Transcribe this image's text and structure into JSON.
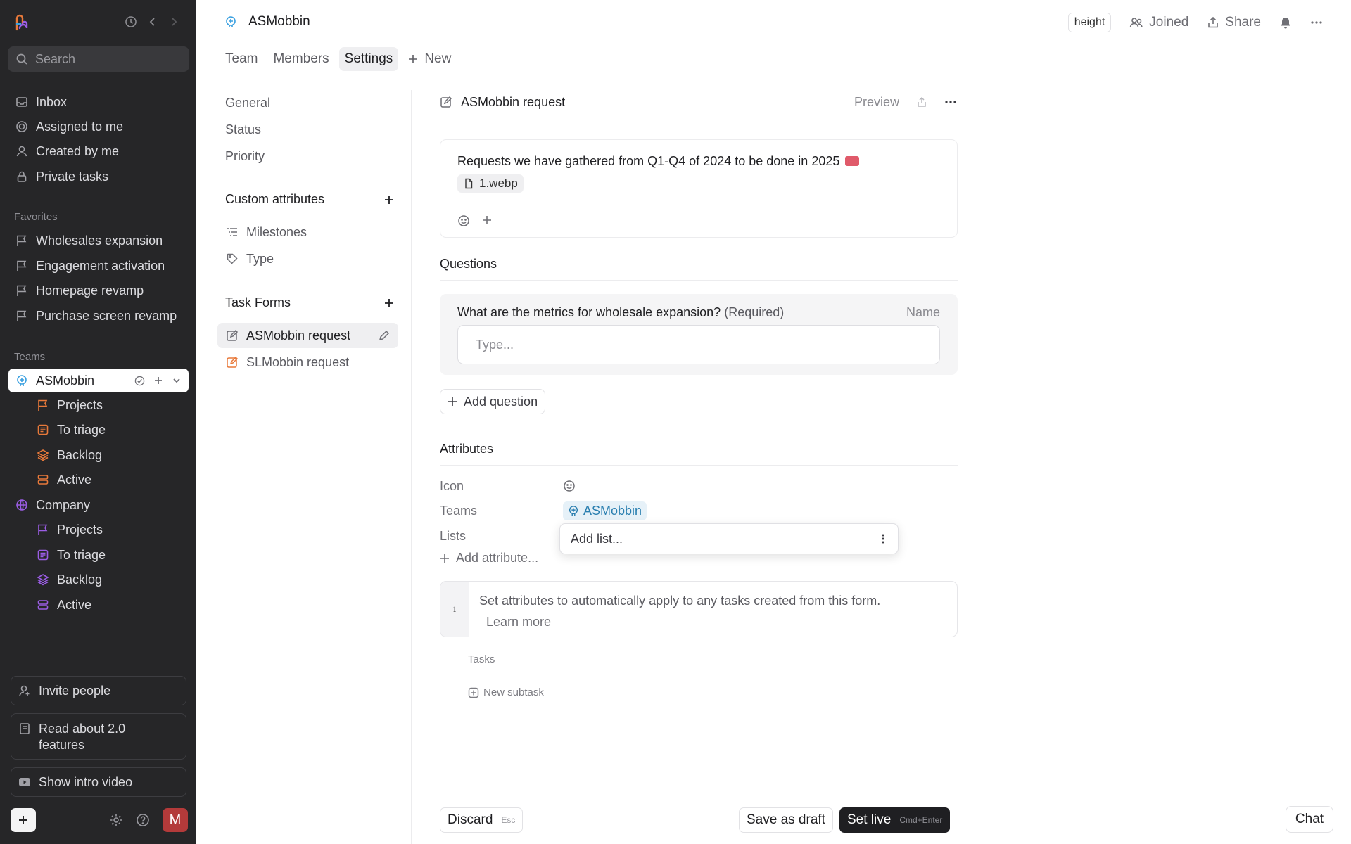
{
  "sidebar": {
    "search_placeholder": "Search",
    "nav": [
      {
        "label": "Inbox",
        "icon": "inbox-icon"
      },
      {
        "label": "Assigned to me",
        "icon": "target-icon"
      },
      {
        "label": "Created by me",
        "icon": "user-icon"
      },
      {
        "label": "Private tasks",
        "icon": "lock-icon"
      }
    ],
    "favorites_heading": "Favorites",
    "favorites": [
      {
        "label": "Wholesales expansion",
        "icon": "flag-icon"
      },
      {
        "label": "Engagement activation",
        "icon": "flag-icon"
      },
      {
        "label": "Homepage revamp",
        "icon": "flag-icon"
      },
      {
        "label": "Purchase screen revamp",
        "icon": "flag-icon"
      }
    ],
    "teams_heading": "Teams",
    "team_asmobbin": {
      "name": "ASMobbin",
      "items": [
        {
          "label": "Projects",
          "icon": "flag-icon"
        },
        {
          "label": "To triage",
          "icon": "triage-icon"
        },
        {
          "label": "Backlog",
          "icon": "layers-icon"
        },
        {
          "label": "Active",
          "icon": "stack-icon"
        }
      ]
    },
    "team_company": {
      "name": "Company",
      "items": [
        {
          "label": "Projects",
          "icon": "flag-icon"
        },
        {
          "label": "To triage",
          "icon": "triage-icon"
        },
        {
          "label": "Backlog",
          "icon": "layers-icon"
        },
        {
          "label": "Active",
          "icon": "stack-icon"
        }
      ]
    },
    "invite_label": "Invite people",
    "read_about_label": "Read about 2.0 features",
    "intro_video_label": "Show intro video",
    "avatar_initial": "M",
    "colors": {
      "background": "#262628",
      "asmobbin_accent": "#e8793a",
      "company_accent": "#9b5de5",
      "avatar": "#b33a3a"
    }
  },
  "header": {
    "title": "ASMobbin",
    "height_badge": "height",
    "joined_label": "Joined",
    "share_label": "Share"
  },
  "tabs": [
    {
      "label": "Team"
    },
    {
      "label": "Members"
    },
    {
      "label": "Settings",
      "active": true
    },
    {
      "label": "New"
    }
  ],
  "settings_nav": {
    "general": "General",
    "status": "Status",
    "priority": "Priority",
    "custom_attributes_heading": "Custom attributes",
    "milestones": "Milestones",
    "type": "Type",
    "task_forms_heading": "Task Forms",
    "form_asmobbin": "ASMobbin request",
    "form_slmobbin": "SLMobbin request"
  },
  "form": {
    "title": "ASMobbin request",
    "preview_label": "Preview",
    "description": "Requests we have gathered from Q1-Q4 of 2024 to be done in 2025",
    "attachment": "1.webp",
    "questions_heading": "Questions",
    "question_text": "What are the metrics for wholesale expansion?",
    "question_required": "(Required)",
    "question_type": "Name",
    "answer_placeholder": "Type...",
    "add_question_label": "Add question",
    "attributes_heading": "Attributes",
    "attr_icon_label": "Icon",
    "attr_teams_label": "Teams",
    "attr_team_value": "ASMobbin",
    "attr_lists_label": "Lists",
    "add_list_placeholder": "Add list...",
    "add_attribute_label": "Add attribute...",
    "info_text": "Set attributes to automatically apply to any tasks created from this form.",
    "learn_more": "Learn more",
    "tasks_label": "Tasks",
    "new_subtask_label": "New subtask"
  },
  "footer": {
    "discard_label": "Discard",
    "discard_shortcut": "Esc",
    "save_draft_label": "Save as draft",
    "set_live_label": "Set live",
    "set_live_shortcut": "Cmd+Enter",
    "chat_label": "Chat"
  }
}
